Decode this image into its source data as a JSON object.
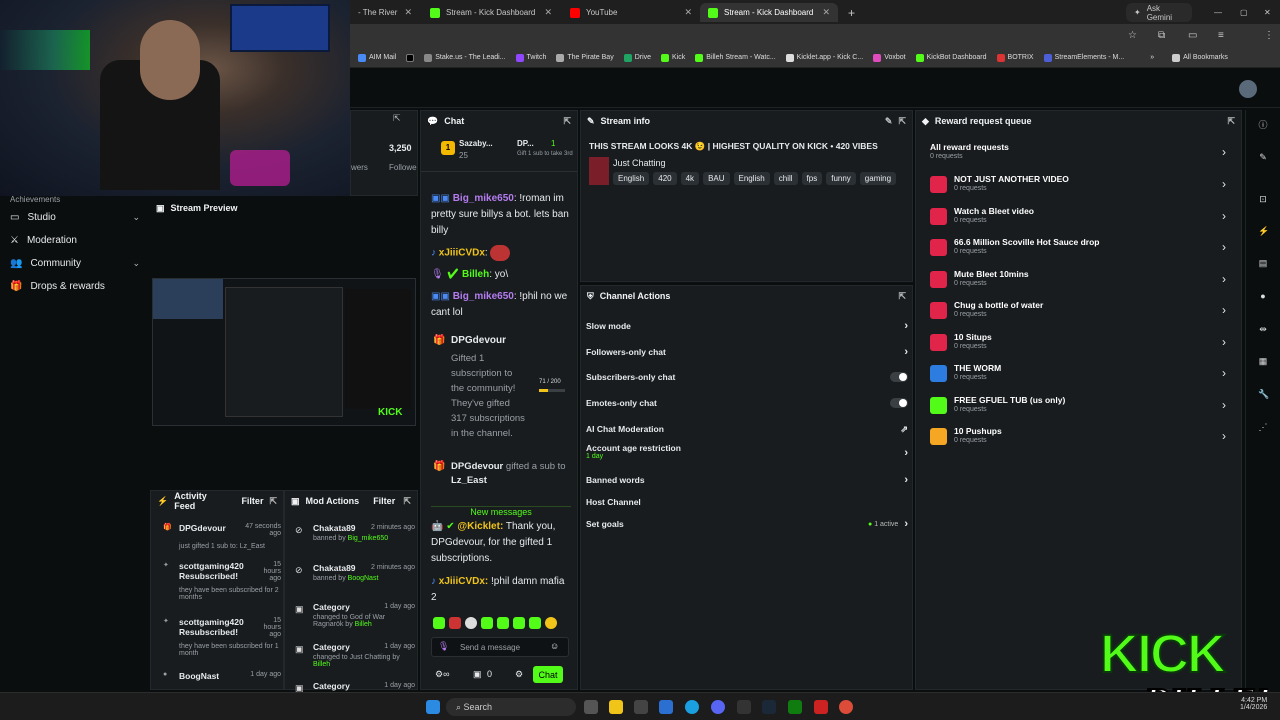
{
  "browser": {
    "tabs": [
      {
        "label": "- The River",
        "active": false
      },
      {
        "label": "Stream - Kick Dashboard",
        "active": false
      },
      {
        "label": "YouTube",
        "active": false
      },
      {
        "label": "Stream - Kick Dashboard",
        "active": true
      }
    ],
    "ask_gemini": "Ask Gemini",
    "bookmarks": [
      "AIM Mail",
      "Stake.us - The Leadi...",
      "Twitch",
      "The Pirate Bay",
      "Drive",
      "Kick",
      "Billeh Stream - Watc...",
      "Kicklet.app - Kick C...",
      "Voxbot",
      "KickBot Dashboard",
      "BOTRIX",
      "StreamElements - M..."
    ],
    "all_bookmarks": "All Bookmarks"
  },
  "sidebar": {
    "items": [
      {
        "label": "Studio",
        "expandable": true
      },
      {
        "label": "Moderation",
        "expandable": false
      },
      {
        "label": "Community",
        "expandable": true
      },
      {
        "label": "Drops & rewards",
        "expandable": false
      }
    ],
    "partial_label": "Achievements"
  },
  "stats": {
    "followers_count": "3,250",
    "viewers_label": "wers",
    "followers_label": "Followe"
  },
  "preview": {
    "title": "Stream Preview"
  },
  "chat": {
    "title": "Chat",
    "top_gifter": {
      "rank": "1",
      "name": "Sazaby...",
      "count": "25"
    },
    "gift_goal": {
      "name": "DP...",
      "count": "1",
      "text": "Gift 1 sub to take 3rd"
    },
    "messages": [
      {
        "user": "Big_mike650",
        "text": "!roman im pretty sure billys a bot. lets ban billy",
        "color": "#b57cf0"
      },
      {
        "user": "xJiiiCVDx",
        "text": "",
        "color": "#f0c419"
      },
      {
        "user": "Billeh",
        "text": "yo\\",
        "color": "#53fc18"
      },
      {
        "user": "Big_mike650",
        "text": "!phil no we cant lol",
        "color": "#b57cf0"
      }
    ],
    "gift_event": {
      "user": "DPGdevour",
      "lines": [
        "Gifted 1",
        "subscription to",
        "the community!",
        "They've gifted",
        "317 subscriptions",
        "in the channel."
      ],
      "progress": "71 / 200",
      "progress_fraction": 0.355
    },
    "gift_event2": {
      "user": "DPGdevour",
      "text": "gifted a sub to",
      "recipient": "Lz_East"
    },
    "new_messages": "New messages",
    "kicklet": {
      "user": "@Kicklet:",
      "text": "Thank you, DPGdevour, for the gifted 1 subscriptions."
    },
    "last": {
      "user": "xJiiiCVDx:",
      "text": "!phil damn mafia 2"
    },
    "input_placeholder": "Send a message",
    "count": "0",
    "send_label": "Chat"
  },
  "stream_info": {
    "title": "Stream info",
    "stream_title": "THIS STREAM LOOKS 4K 😉 | HIGHEST QUALITY ON KICK • 420 VIBES",
    "category": "Just Chatting",
    "tags": [
      "English",
      "420",
      "4k",
      "BAU",
      "English",
      "chill",
      "fps",
      "funny",
      "gaming"
    ]
  },
  "channel_actions": {
    "title": "Channel Actions",
    "rows": [
      {
        "label": "Slow mode",
        "type": "arrow"
      },
      {
        "label": "Followers-only chat",
        "type": "arrow"
      },
      {
        "label": "Subscribers-only chat",
        "type": "toggle"
      },
      {
        "label": "Emotes-only chat",
        "type": "toggle"
      },
      {
        "label": "AI Chat Moderation",
        "type": "link"
      },
      {
        "label": "Account age restriction",
        "sub": "1 day",
        "type": "arrow"
      },
      {
        "label": "Banned words",
        "type": "arrow"
      },
      {
        "label": "Host Channel",
        "type": "none"
      },
      {
        "label": "Set goals",
        "badge": "1 active",
        "type": "arrow"
      }
    ]
  },
  "rewards": {
    "title": "Reward request queue",
    "all": {
      "label": "All reward requests",
      "sub": "0 requests"
    },
    "items": [
      {
        "label": "NOT JUST ANOTHER VIDEO",
        "sub": "0 requests",
        "color": "#e0244a"
      },
      {
        "label": "Watch a Bleet video",
        "sub": "0 requests",
        "color": "#e0244a"
      },
      {
        "label": "66.6 Million Scoville Hot Sauce drop",
        "sub": "0 requests",
        "color": "#e0244a"
      },
      {
        "label": "Mute Bleet 10mins",
        "sub": "0 requests",
        "color": "#e0244a"
      },
      {
        "label": "Chug a bottle of water",
        "sub": "0 requests",
        "color": "#e0244a"
      },
      {
        "label": "10 Situps",
        "sub": "0 requests",
        "color": "#e0244a"
      },
      {
        "label": "THE WORM",
        "sub": "0 requests",
        "color": "#2d7ce0"
      },
      {
        "label": "FREE GFUEL TUB (us only)",
        "sub": "0 requests",
        "color": "#53fc18"
      },
      {
        "label": "10 Pushups",
        "sub": "0 requests",
        "color": "#f5a623"
      }
    ]
  },
  "activity": {
    "title": "Activity Feed",
    "filter": "Filter",
    "items": [
      {
        "name": "DPGdevour",
        "time": "47 seconds ago",
        "text": "just gifted 1 sub to: Lz_East"
      },
      {
        "name": "scottgaming420 Resubscribed!",
        "time": "15 hours ago",
        "text": "they have been subscribed for 2 months"
      },
      {
        "name": "scottgaming420 Resubscribed!",
        "time": "15 hours ago",
        "text": "they have been subscribed for 1 month"
      },
      {
        "name": "BoogNast",
        "time": "1 day ago",
        "text": ""
      }
    ]
  },
  "mod": {
    "title": "Mod Actions",
    "filter": "Filter",
    "items": [
      {
        "name": "Chakata89",
        "time": "2 minutes ago",
        "text": "banned by",
        "target": "Big_mike650"
      },
      {
        "name": "Chakata89",
        "time": "2 minutes ago",
        "text": "banned by",
        "target": "BoogNast"
      },
      {
        "name": "Category",
        "time": "1 day ago",
        "text": "changed to God of War Ragnarök by",
        "target": "Billeh"
      },
      {
        "name": "Category",
        "time": "1 day ago",
        "text": "changed to Just Chatting by",
        "target": "Billeh"
      },
      {
        "name": "Category",
        "time": "1 day ago",
        "text": "changed to Tom Clancy's",
        "target": ""
      }
    ]
  },
  "taskbar": {
    "search": "Search",
    "time": "4:42 PM",
    "date": "1/4/2026"
  },
  "overlay": {
    "brand_top": "KICK",
    "brand_bottom": "BILLEH"
  }
}
